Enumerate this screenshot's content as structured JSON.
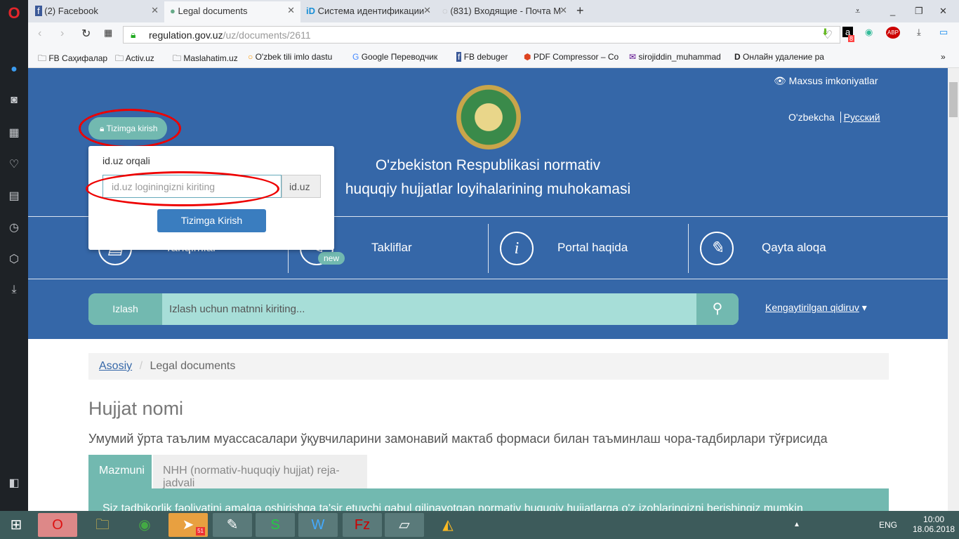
{
  "browser": {
    "tabs": [
      {
        "label": "(2) Facebook"
      },
      {
        "label": "Legal documents"
      },
      {
        "label": "Система идентификации"
      },
      {
        "label": "(831) Входящие - Почта М"
      }
    ],
    "url_host": "regulation.gov.uz",
    "url_path": "/uz/documents/2611",
    "bookmarks": [
      "FB Саҳифалар",
      "Activ.uz",
      "Maslahatim.uz",
      "O'zbek tili imlo dastu",
      "Google Переводчик",
      "FB debuger",
      "PDF Compressor – Co",
      "sirojiddin_muhammad",
      "Онлайн удаление ра"
    ],
    "amazon_badge": "8"
  },
  "site": {
    "accessibility": "Maxsus imkoniyatlar",
    "lang_uz": "O'zbekcha",
    "lang_ru": "Русский",
    "login_button": "Tizimga kirish",
    "title_line1": "O'zbekiston Respublikasi normativ",
    "title_line2": "huquqiy hujjatlar loyihalarining muhokamasi",
    "login_popup": {
      "label": "id.uz orqali",
      "placeholder": "id.uz loginingizni kiriting",
      "addon": "id.uz",
      "submit": "Tizimga Kirish"
    },
    "nav": [
      {
        "label": "Tanqimlar"
      },
      {
        "label": "Takliflar",
        "badge": "new"
      },
      {
        "label": "Portal haqida"
      },
      {
        "label": "Qayta aloqa"
      }
    ],
    "search": {
      "label": "Izlash",
      "placeholder": "Izlash uchun matnni kiriting...",
      "advanced": "Kengaytirilgan qidiruv"
    },
    "breadcrumb": {
      "home": "Asosiy",
      "current": "Legal documents"
    },
    "doc_heading": "Hujjat nomi",
    "doc_title": "Умумий ўрта таълим муассасалари ўқувчиларини замонавий мактаб формаси билан таъминлаш чора-тадбирлари тўғрисида",
    "content_tabs": [
      "Mazmuni",
      "NHH (normativ-huquqiy hujjat) reja-jadvali"
    ],
    "content_text": "Siz tadbikorlik faoliyatini amalga oshirishga ta'sir etuvchi qabul qilinayotgan normativ huquqiy hujjatlarga o'z izohlaringizni berishingiz mumkin"
  },
  "taskbar": {
    "lang": "ENG",
    "time": "10:00",
    "date": "18.06.2018",
    "telegram_badge": "51"
  },
  "colors": {
    "header": "#3567a8",
    "teal": "#72b9b0",
    "annotation": "#e00000"
  }
}
